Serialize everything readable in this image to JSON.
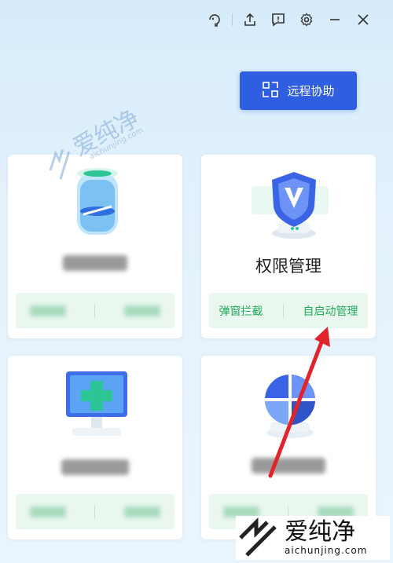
{
  "titlebar": {
    "icons": [
      "skin-icon",
      "share-icon",
      "feedback-icon",
      "settings-icon",
      "minimize-icon",
      "close-icon"
    ]
  },
  "remote_button": {
    "label": "远程协助",
    "icon": "remote-assist-icon"
  },
  "cards": [
    {
      "id": "top-left",
      "title": "",
      "blurred": true,
      "actions": [
        "",
        ""
      ]
    },
    {
      "id": "permission",
      "title": "权限管理",
      "blurred": false,
      "actions": [
        "弹窗拦截",
        "自启动管理"
      ]
    },
    {
      "id": "bottom-left",
      "title": "",
      "blurred": true,
      "actions": [
        "",
        ""
      ]
    },
    {
      "id": "bottom-right",
      "title": "",
      "blurred": true,
      "actions": [
        "",
        ""
      ]
    }
  ],
  "watermark": {
    "brand": "爱纯净",
    "url": "aichunjing.com"
  },
  "colors": {
    "primary": "#2f5fe0",
    "action_green": "#23a85b",
    "action_bg": "#eaf7ef",
    "arrow": "#e0242a"
  }
}
